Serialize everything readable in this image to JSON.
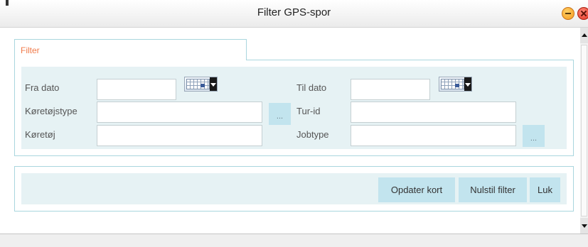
{
  "window": {
    "title": "Filter GPS-spor"
  },
  "tab": {
    "label": "Filter"
  },
  "filter": {
    "fra_dato_label": "Fra dato",
    "fra_dato_value": "",
    "til_dato_label": "Til dato",
    "til_dato_value": "",
    "koretojstype_label": "Køretøjstype",
    "koretojstype_value": "",
    "koretoj_label": "Køretøj",
    "koretoj_value": "",
    "tur_id_label": "Tur-id",
    "tur_id_value": "",
    "jobtype_label": "Jobtype",
    "jobtype_value": "",
    "browse_label": "..."
  },
  "actions": {
    "update_map": "Opdater kort",
    "reset_filter": "Nulstil filter",
    "close": "Luk"
  },
  "icons": {
    "minimize": "minimize-icon",
    "close": "close-icon",
    "calendar": "calendar-icon"
  },
  "colors": {
    "panel_background": "#e6f2f4",
    "panel_border": "#a9d6de",
    "button_background": "#c2e4ee",
    "tab_label": "#f07a4a"
  }
}
